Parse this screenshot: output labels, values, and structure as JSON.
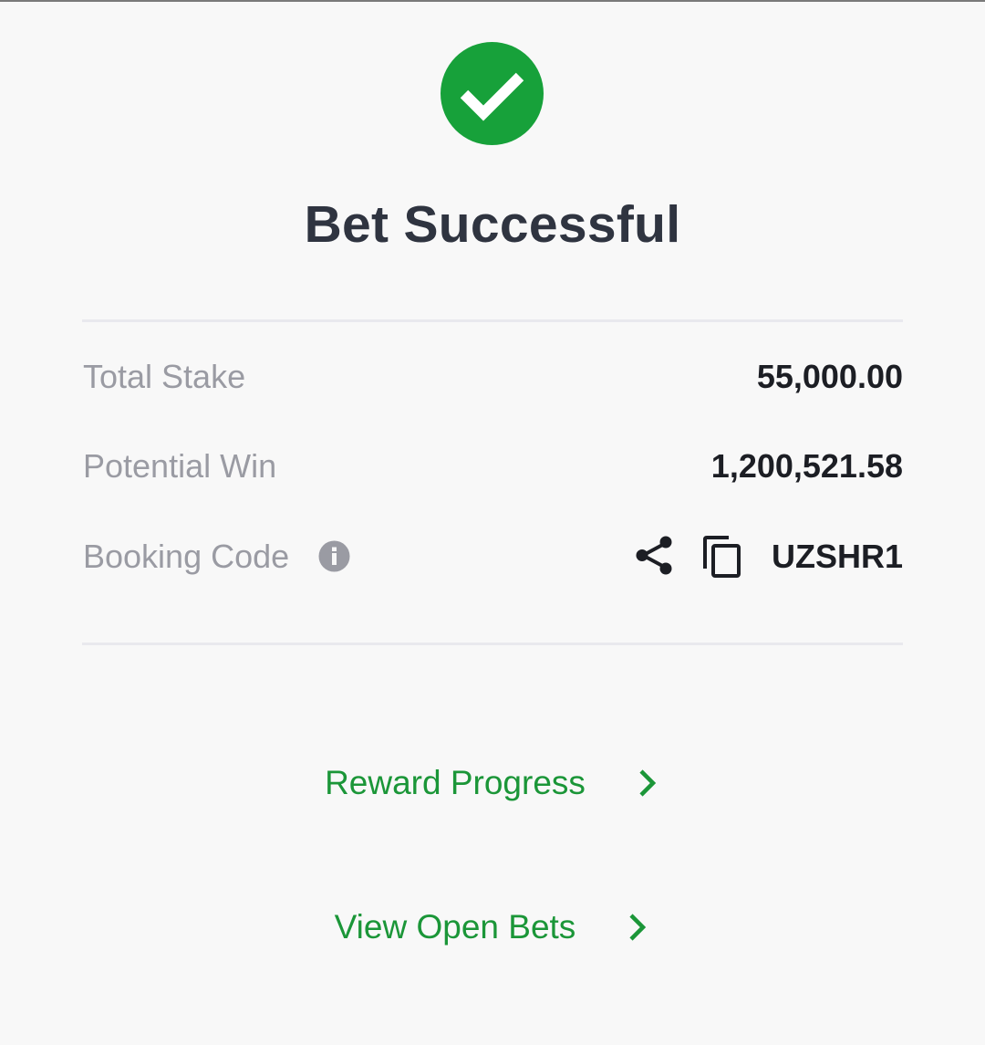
{
  "status": {
    "icon": "check-circle-icon",
    "title": "Bet Successful"
  },
  "summary": {
    "total_stake_label": "Total Stake",
    "total_stake_value": "55,000.00",
    "potential_win_label": "Potential Win",
    "potential_win_value": "1,200,521.58",
    "booking_code_label": "Booking Code",
    "booking_code_value": "UZSHR1",
    "booking_code_icons": [
      "info-icon",
      "share-icon",
      "copy-icon"
    ]
  },
  "links": {
    "reward_progress": "Reward Progress",
    "view_open_bets": "View Open Bets"
  },
  "colors": {
    "success_green": "#17a13a",
    "link_green": "#1b9638",
    "title_text": "#2f3440",
    "label_gray": "#9a9ba3",
    "value_text": "#1c1e24"
  }
}
